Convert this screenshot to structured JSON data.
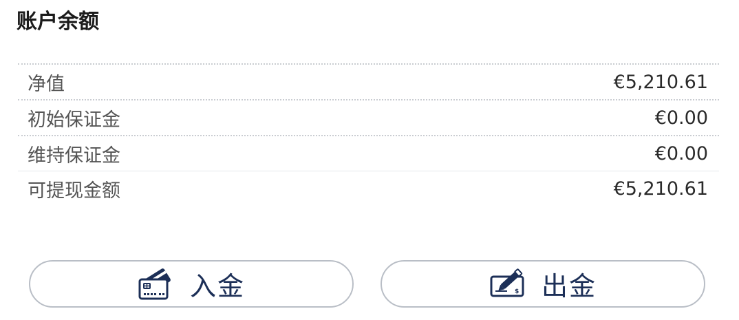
{
  "header": {
    "title": "账户余额"
  },
  "balances": [
    {
      "label": "净值",
      "value": "€5,210.61"
    },
    {
      "label": "初始保证金",
      "value": "€0.00"
    },
    {
      "label": "维持保证金",
      "value": "€0.00"
    },
    {
      "label": "可提现金额",
      "value": "€5,210.61"
    }
  ],
  "actions": {
    "deposit": {
      "label": "入金",
      "icon": "credit-card-icon"
    },
    "withdraw": {
      "label": "出金",
      "icon": "cheque-pen-icon"
    }
  },
  "colors": {
    "accent": "#1c2f57",
    "border": "#b9bec6",
    "label_text": "#555555"
  }
}
